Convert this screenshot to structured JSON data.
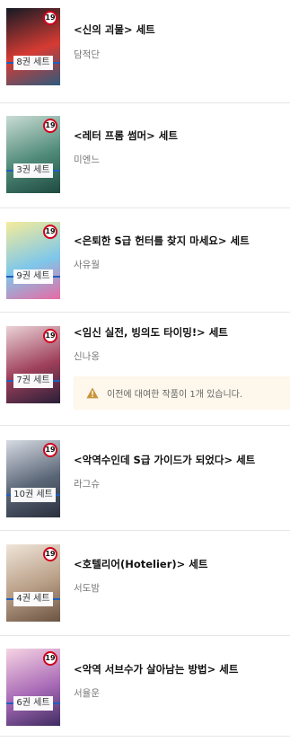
{
  "badge_label": "19",
  "items": [
    {
      "title": "<신의 괴물> 세트",
      "author": "담적단",
      "volumes": "8권 세트",
      "cover_colors": [
        "#141a24",
        "#d63b33",
        "#2e5a7d"
      ]
    },
    {
      "title": "<레터 프롬 썸머> 세트",
      "author": "미엔느",
      "volumes": "3권 세트",
      "cover_colors": [
        "#c9dcd4",
        "#4f8a78",
        "#1e4a40"
      ]
    },
    {
      "title": "<은퇴한 S급 헌터를 찾지 마세요> 세트",
      "author": "사유월",
      "volumes": "9권 세트",
      "cover_colors": [
        "#f5ec9a",
        "#7ec7ea",
        "#e86aa3"
      ]
    },
    {
      "title": "<임신 실전, 빙의도 타이밍!> 세트",
      "author": "신나옹",
      "volumes": "7권 세트",
      "cover_colors": [
        "#ead2d6",
        "#9e3f5a",
        "#2a1f38"
      ]
    },
    {
      "title": "<악역수인데 S급 가이드가 되었다> 세트",
      "author": "라그슈",
      "volumes": "10권 세트",
      "cover_colors": [
        "#d7dbe3",
        "#5a6677",
        "#2a2f3d"
      ]
    },
    {
      "title": "<호텔리어(Hotelier)> 세트",
      "author": "서도밤",
      "volumes": "4권 세트",
      "cover_colors": [
        "#efe5d9",
        "#b89d85",
        "#6b5443"
      ]
    },
    {
      "title": "<악역 서브수가 살아남는 방법> 세트",
      "author": "서율운",
      "volumes": "6권 세트",
      "cover_colors": [
        "#f6d4e3",
        "#a86ab6",
        "#3f2c62"
      ]
    }
  ],
  "notice": {
    "text": "이전에 대여한 작품이 1개 있습니다.",
    "icon": "warning-icon",
    "color": "#c9943a",
    "background": "#fdf7ec"
  },
  "colors": {
    "adult_badge_border": "#d0021b",
    "volume_line": "#1f5fbf"
  }
}
